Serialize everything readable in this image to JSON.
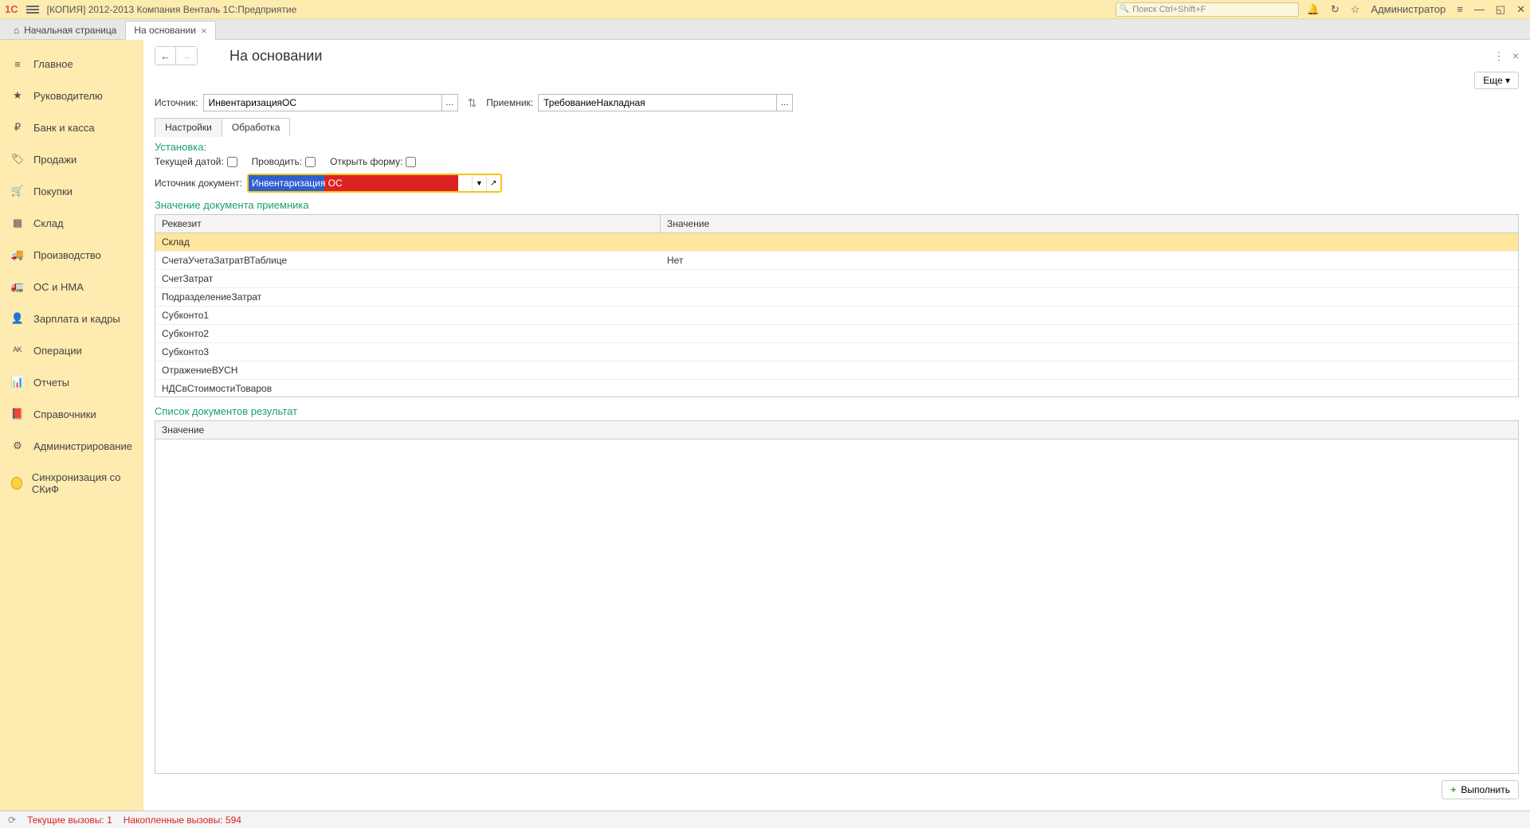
{
  "title_bar": {
    "logo": "1C",
    "app_title": "[КОПИЯ] 2012-2013 Компания Венталь 1С:Предприятие",
    "search_placeholder": "Поиск Ctrl+Shift+F",
    "admin": "Администратор"
  },
  "tabs": {
    "home": "Начальная страница",
    "current": "На основании"
  },
  "sidebar": [
    {
      "icon": "≡",
      "label": "Главное"
    },
    {
      "icon": "★",
      "label": "Руководителю"
    },
    {
      "icon": "₽",
      "label": "Банк и касса"
    },
    {
      "icon": "🏷",
      "label": "Продажи"
    },
    {
      "icon": "🛒",
      "label": "Покупки"
    },
    {
      "icon": "▦",
      "label": "Склад"
    },
    {
      "icon": "🚚",
      "label": "Производство"
    },
    {
      "icon": "🚛",
      "label": "ОС и HMA"
    },
    {
      "icon": "👤",
      "label": "Зарплата и кадры"
    },
    {
      "icon": "ᴬᴷ",
      "label": "Операции"
    },
    {
      "icon": "📊",
      "label": "Отчеты"
    },
    {
      "icon": "📕",
      "label": "Справочники"
    },
    {
      "icon": "⚙",
      "label": "Администрирование"
    },
    {
      "icon": "",
      "label": "Синхронизация со СКиФ",
      "sync": true
    }
  ],
  "content": {
    "page_title": "На основании",
    "more_btn": "Еще ▾",
    "source_label": "Источник:",
    "source_value": "ИнвентаризацияОС",
    "dest_label": "Приемник:",
    "dest_value": "ТребованиеНакладная",
    "swap_btn": "…",
    "inner_tabs": [
      "Настройки",
      "Обработка"
    ],
    "section_setup": "Установка:",
    "check_currdate": "Текущей датой:",
    "check_post": "Проводить:",
    "check_openform": "Открыть форму:",
    "doc_source_label": "Источник документ:",
    "doc_source_value": "Инвентаризация ОС ",
    "section_attrs": "Значение документа приемника",
    "attr_headers": [
      "Реквезит",
      "Значение"
    ],
    "attr_rows": [
      {
        "name": "Склад",
        "value": "",
        "selected": true
      },
      {
        "name": "СчетаУчетаЗатратВТаблице",
        "value": "Нет"
      },
      {
        "name": "СчетЗатрат",
        "value": ""
      },
      {
        "name": "ПодразделениеЗатрат",
        "value": ""
      },
      {
        "name": "Субконто1",
        "value": ""
      },
      {
        "name": "Субконто2",
        "value": ""
      },
      {
        "name": "Субконто3",
        "value": ""
      },
      {
        "name": "ОтражениеВУСН",
        "value": ""
      },
      {
        "name": "НДСвСтоимостиТоваров",
        "value": ""
      }
    ],
    "section_result": "Список документов результат",
    "result_header": "Значение",
    "exec_btn": "Выполнить"
  },
  "status": {
    "current_calls": "Текущие вызовы: 1",
    "accum_calls": "Накопленные вызовы: 594"
  }
}
